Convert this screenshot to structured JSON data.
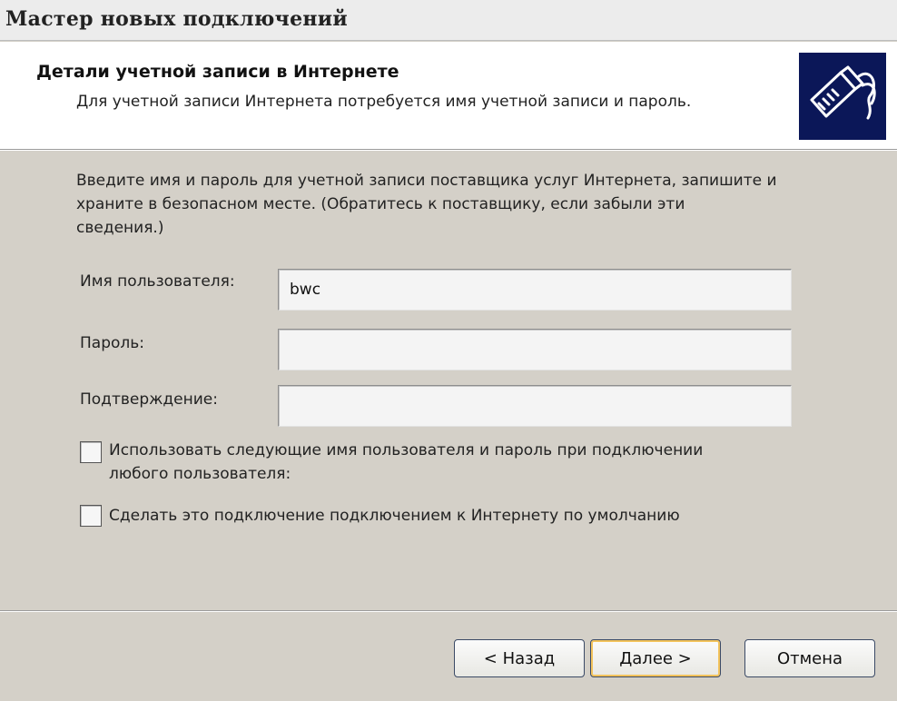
{
  "window": {
    "title": "Мастер новых подключений"
  },
  "header": {
    "title": "Детали учетной записи в Интернете",
    "subtitle": "Для учетной записи Интернета потребуется имя учетной записи и пароль.",
    "icon": "network-cable-icon"
  },
  "description": {
    "line1": "Введите имя и пароль для учетной записи поставщика услуг Интернета, запишите и",
    "line2": "храните в безопасном месте. (Обратитесь к поставщику, если забыли эти",
    "line3": "сведения.)"
  },
  "form": {
    "username": {
      "label": "Имя пользователя:",
      "value": "bwc"
    },
    "password": {
      "label": "Пароль:",
      "value": ""
    },
    "confirm": {
      "label": "Подтверждение:",
      "value": ""
    }
  },
  "options": {
    "use_for_all": {
      "line1": "Использовать следующие имя пользователя и пароль при подключении",
      "line2": "любого пользователя:",
      "checked": false
    },
    "make_default": {
      "label": "Сделать это подключение подключением к Интернету по умолчанию",
      "checked": false
    }
  },
  "buttons": {
    "back": "< Назад",
    "next": "Далее >",
    "cancel": "Отмена"
  },
  "colors": {
    "dialog_bg": "#d4d0c8",
    "header_bg": "#ffffff",
    "icon_bg": "#0b1758",
    "button_border": "#3b4a66",
    "default_button_highlight": "#f3c35c"
  }
}
